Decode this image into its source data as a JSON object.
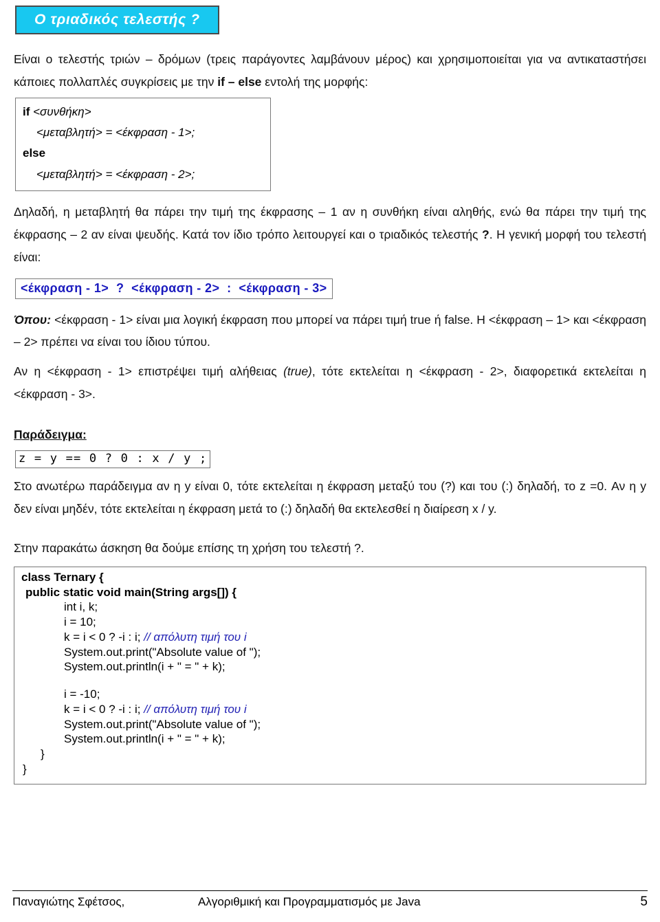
{
  "title_banner": "Ο τριαδικός τελεστής ?",
  "intro": {
    "part1": "Είναι ο τελεστής τριών – δρόμων (τρεις παράγοντες λαμβάνουν μέρος) και χρησιμοποιείται για να αντικαταστήσει κάποιες πολλαπλές συγκρίσεις με την ",
    "keyword": "if – else",
    "part2": " εντολή της μορφής:"
  },
  "ifelse_box": {
    "line1_kw": "if",
    "line1_cond": "<συνθήκη>",
    "line2": "<μεταβλητή>  =  <έκφραση - 1>;",
    "line3_kw": "else",
    "line4": "<μεταβλητή>  =  <έκφραση - 2>;"
  },
  "explain1": "Δηλαδή, η μεταβλητή θα πάρει την τιμή της έκφρασης – 1 αν η συνθήκη είναι αληθής, ενώ θα πάρει την τιμή της έκφρασης – 2 αν είναι ψευδής. Κατά τον ίδιο τρόπο λειτουργεί και ο τριαδικός τελεστής ",
  "explain1_bold": "?",
  "explain1_tail": ". Η γενική μορφή του τελεστή είναι:",
  "formula": "<έκφραση - 1>  ?  <έκφραση - 2>  :  <έκφραση - 3>",
  "formula_color": "#1a1abe",
  "where": {
    "label": "Όπου:",
    "text": " <έκφραση - 1> είναι μια λογική έκφραση που μπορεί να πάρει τιμή true ή false. Η <έκφραση – 1> και <έκφραση – 2> πρέπει να είναι του ίδιου τύπου."
  },
  "rule": {
    "part1": "Αν η <έκφραση - 1> επιστρέψει τιμή αλήθειας ",
    "true_italic": "(true)",
    "part2": ", τότε εκτελείται η <έκφραση - 2>, διαφορετικά εκτελείται η <έκφραση - 3>."
  },
  "example_heading": "Παράδειγμα:",
  "example_code": "z = y == 0 ? 0 : x / y ;",
  "example_explain": "Στο ανωτέρω παράδειγμα αν η y είναι 0, τότε εκτελείται η έκφραση μεταξύ του (?) και του (:) δηλαδή, το z =0. Αν η y δεν είναι μηδέν, τότε εκτελείται η έκφραση μετά το (:) δηλαδή θα εκτελεσθεί η διαίρεση x / y.",
  "exercise_intro": "Στην παρακάτω άσκηση θα δούμε επίσης τη χρήση του τελεστή ?.",
  "java_listing": {
    "line_class": "class Ternary {",
    "line_main": "public static void main(String args[]) {",
    "lines": [
      "int i, k;",
      "i = 10;",
      "System.out.print(\"Absolute value of \");",
      "System.out.println(i + \" = \" + k);",
      "i = -10;"
    ],
    "ternary_code": "k = i < 0 ? -i : i; ",
    "ternary_comment": "// απόλυτη τιμή του i",
    "print1": "System.out.print(\"Absolute value of \");",
    "print2": "System.out.println(i + \" = \" + k);",
    "decl1": "int i, k;",
    "decl2": "i = 10;",
    "decl3": "i = -10;",
    "close_inner": "}",
    "close_outer": "}",
    "comment_color": "#2222b4"
  },
  "footer": {
    "author": "Παναγιώτης Σφέτσος,",
    "title": "Αλγοριθμική και Προγραμματισμός με Java",
    "page": "5"
  }
}
